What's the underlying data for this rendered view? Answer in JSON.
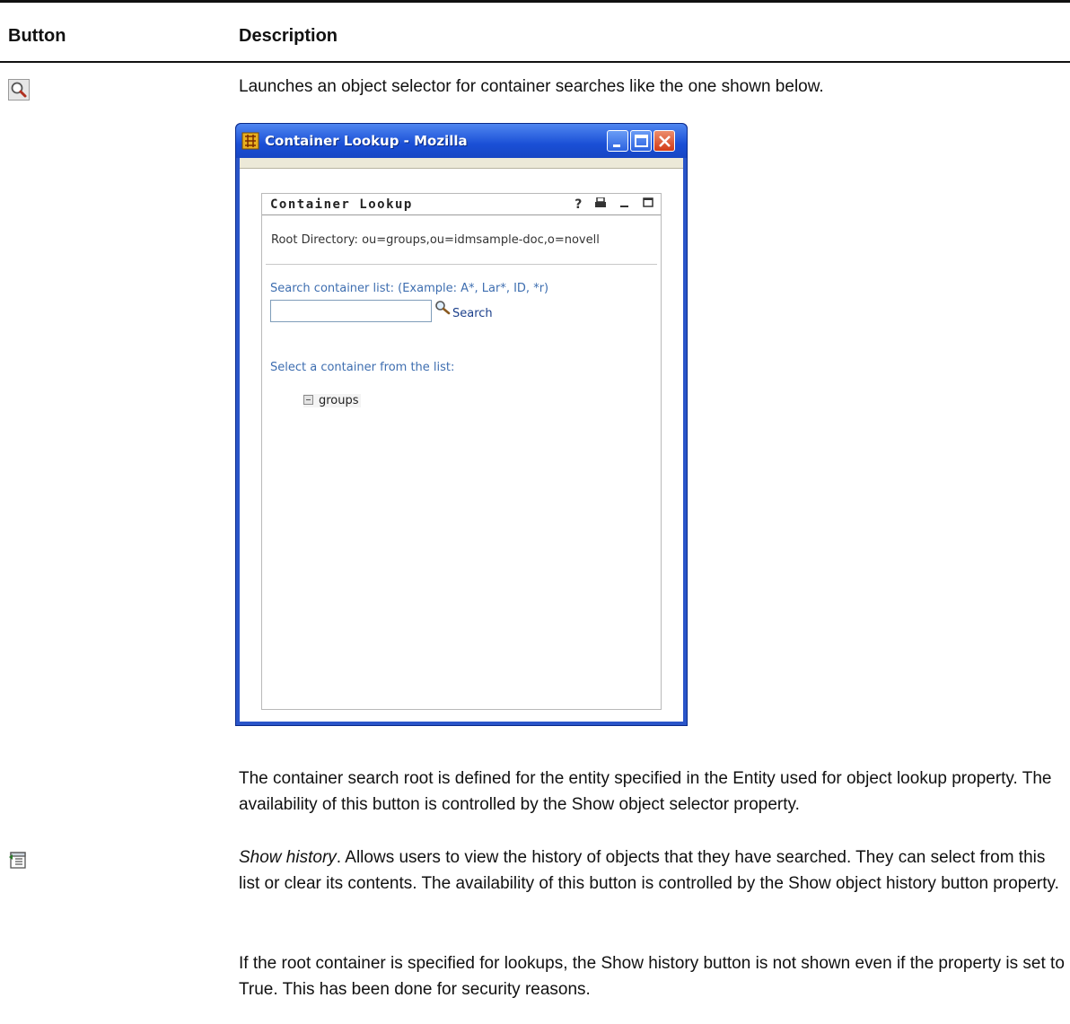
{
  "table": {
    "headers": [
      "Button",
      "Description"
    ],
    "rows": [
      {
        "icon": "magnifier-icon",
        "paragraphs": [
          "Launches an object selector for container searches like the one shown below.",
          "The container search root is defined for the entity specified in the Entity used for object lookup property. The availability of this button is controlled by the Show object selector property."
        ]
      },
      {
        "icon": "history-icon",
        "term": "Show history",
        "paragraphs": [
          ". Allows users to view the history of objects that they have searched. They can select from this list or clear its contents. The availability of this button is controlled by the Show object history button property.",
          "If the root container is specified for lookups, the Show history button is not shown even if the property is set to True. This has been done for security reasons."
        ]
      }
    ]
  },
  "screenshot": {
    "window_title": "Container Lookup - Mozilla",
    "portlet_title": "Container Lookup",
    "portlet_controls": [
      "?",
      "help",
      "print",
      "minimize",
      "maximize"
    ],
    "root_directory": "Root Directory: ou=groups,ou=idmsample-doc,o=novell",
    "search_label": "Search container list: (Example: A*, Lar*, ID, *r)",
    "search_input_value": "",
    "search_button": "Search",
    "select_label": "Select a container from the list:",
    "tree_items": [
      "groups"
    ]
  },
  "colors": {
    "xp_title_blue": "#1a4fd6",
    "link_blue": "#3e6eb0"
  }
}
